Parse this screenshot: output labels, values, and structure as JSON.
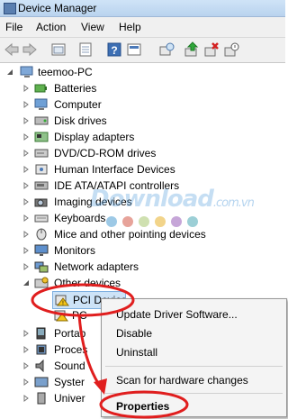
{
  "window": {
    "title": "Device Manager"
  },
  "menu": [
    "File",
    "Action",
    "View",
    "Help"
  ],
  "toolbar": [
    "back",
    "forward",
    "up-folder",
    "properties",
    "help",
    "show-hidden",
    "scan",
    "update-driver",
    "uninstall",
    "disable"
  ],
  "tree": {
    "root": "teemoo-PC",
    "items": [
      {
        "label": "Batteries",
        "icon": "battery-icon"
      },
      {
        "label": "Computer",
        "icon": "computer-icon"
      },
      {
        "label": "Disk drives",
        "icon": "disk-drive-icon"
      },
      {
        "label": "Display adapters",
        "icon": "display-adapter-icon"
      },
      {
        "label": "DVD/CD-ROM drives",
        "icon": "dvd-drive-icon"
      },
      {
        "label": "Human Interface Devices",
        "icon": "hid-icon"
      },
      {
        "label": "IDE ATA/ATAPI controllers",
        "icon": "ide-controller-icon"
      },
      {
        "label": "Imaging devices",
        "icon": "camera-icon"
      },
      {
        "label": "Keyboards",
        "icon": "keyboard-icon"
      },
      {
        "label": "Mice and other pointing devices",
        "icon": "mouse-icon"
      },
      {
        "label": "Monitors",
        "icon": "monitor-icon"
      },
      {
        "label": "Network adapters",
        "icon": "network-adapter-icon"
      },
      {
        "label": "Other devices",
        "icon": "other-devices-icon"
      }
    ],
    "other_children": [
      "PCI Device",
      "PC"
    ],
    "after_items": [
      "Portab",
      "Proces",
      "Sound",
      "Syster",
      "Univer"
    ]
  },
  "context_menu": {
    "items": [
      "Update Driver Software...",
      "Disable",
      "Uninstall",
      "Scan for hardware changes",
      "Properties"
    ],
    "highlighted": "Properties"
  },
  "watermark": {
    "text": "Download",
    "suffix": ".com.vn",
    "dot_colors": [
      "#9dc9e6",
      "#e7a39a",
      "#cfe0b0",
      "#f2d48a",
      "#c6a6d8",
      "#9ccfd6"
    ]
  },
  "annotation_color": "#e01e1e"
}
